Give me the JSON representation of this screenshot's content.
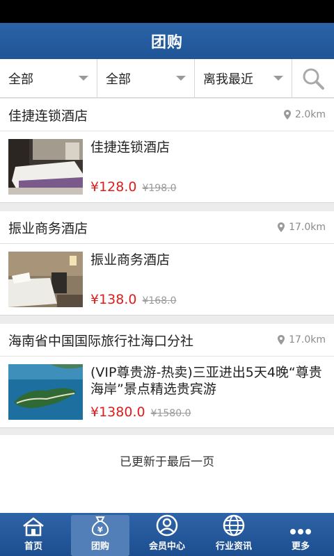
{
  "header": {
    "title": "团购"
  },
  "filters": [
    {
      "label": "全部"
    },
    {
      "label": "全部"
    },
    {
      "label": "离我最近"
    }
  ],
  "deals": [
    {
      "store": "佳捷连锁酒店",
      "distance": "2.0km",
      "title": "佳捷连锁酒店",
      "price": "¥128.0",
      "old_price": "¥198.0"
    },
    {
      "store": "振业商务酒店",
      "distance": "17.0km",
      "title": "振业商务酒店",
      "price": "¥138.0",
      "old_price": "¥168.0"
    },
    {
      "store": "海南省中国国际旅行社海口分社",
      "distance": "17.0km",
      "title": "(VIP尊贵游-热卖)三亚进出5天4晚“尊贵海岸”景点精选贵宾游",
      "price": "¥1380.0",
      "old_price": "¥1580.0"
    }
  ],
  "footer_message": "已更新于最后一页",
  "tabbar": {
    "items": [
      {
        "label": "首页",
        "icon": "home-icon"
      },
      {
        "label": "团购",
        "icon": "money-bag-icon"
      },
      {
        "label": "会员中心",
        "icon": "user-icon"
      },
      {
        "label": "行业资讯",
        "icon": "globe-icon"
      },
      {
        "label": "更多",
        "icon": "more-icon"
      }
    ],
    "active": "团购"
  },
  "colors": {
    "primary": "#1f5596",
    "price": "#e01b1b"
  }
}
